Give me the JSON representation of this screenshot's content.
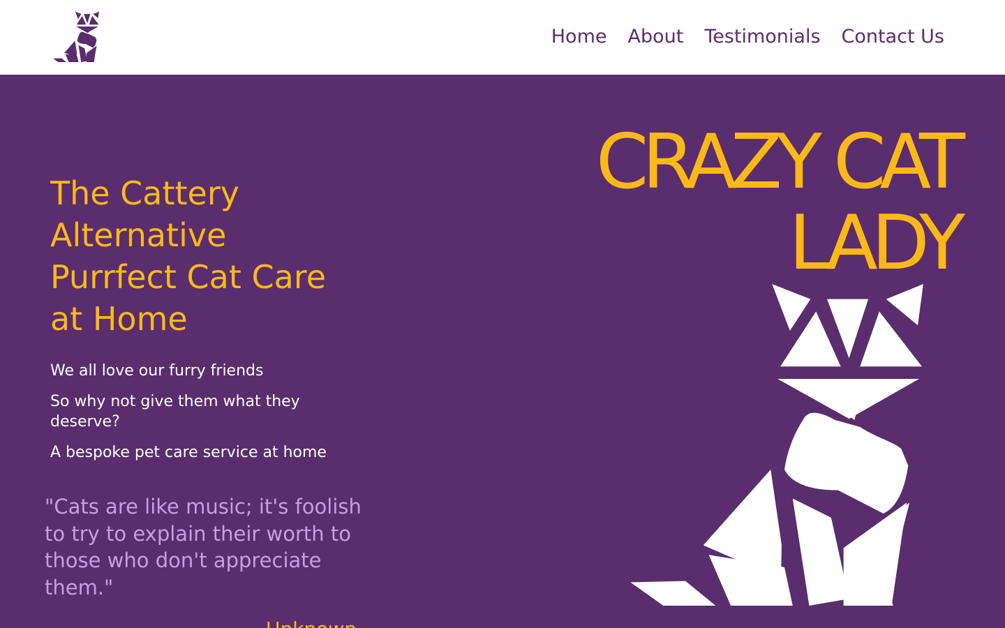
{
  "colors": {
    "brand_purple": "#5a2d6e",
    "accent_yellow": "#fbb917",
    "quote_lilac": "#c79fe0",
    "white": "#ffffff"
  },
  "header": {
    "logo_icon": "geometric-cat-logo",
    "nav": [
      "Home",
      "About",
      "Testimonials",
      "Contact Us"
    ]
  },
  "hero": {
    "tagline": [
      "The Cattery",
      "Alternative",
      "Purrfect Cat Care",
      "at Home"
    ],
    "paragraphs": [
      "We all love our furry friends",
      "So why not give them what they deserve?",
      "A bespoke pet care service at home"
    ],
    "quote": "\"Cats are like music; it's foolish to try to explain their worth to those who don't appreciate them.\"",
    "quote_author": "- Unknown",
    "brand_lines": [
      "CRAZY CAT",
      "LADY"
    ],
    "illustration_icon": "geometric-cat-illustration"
  }
}
